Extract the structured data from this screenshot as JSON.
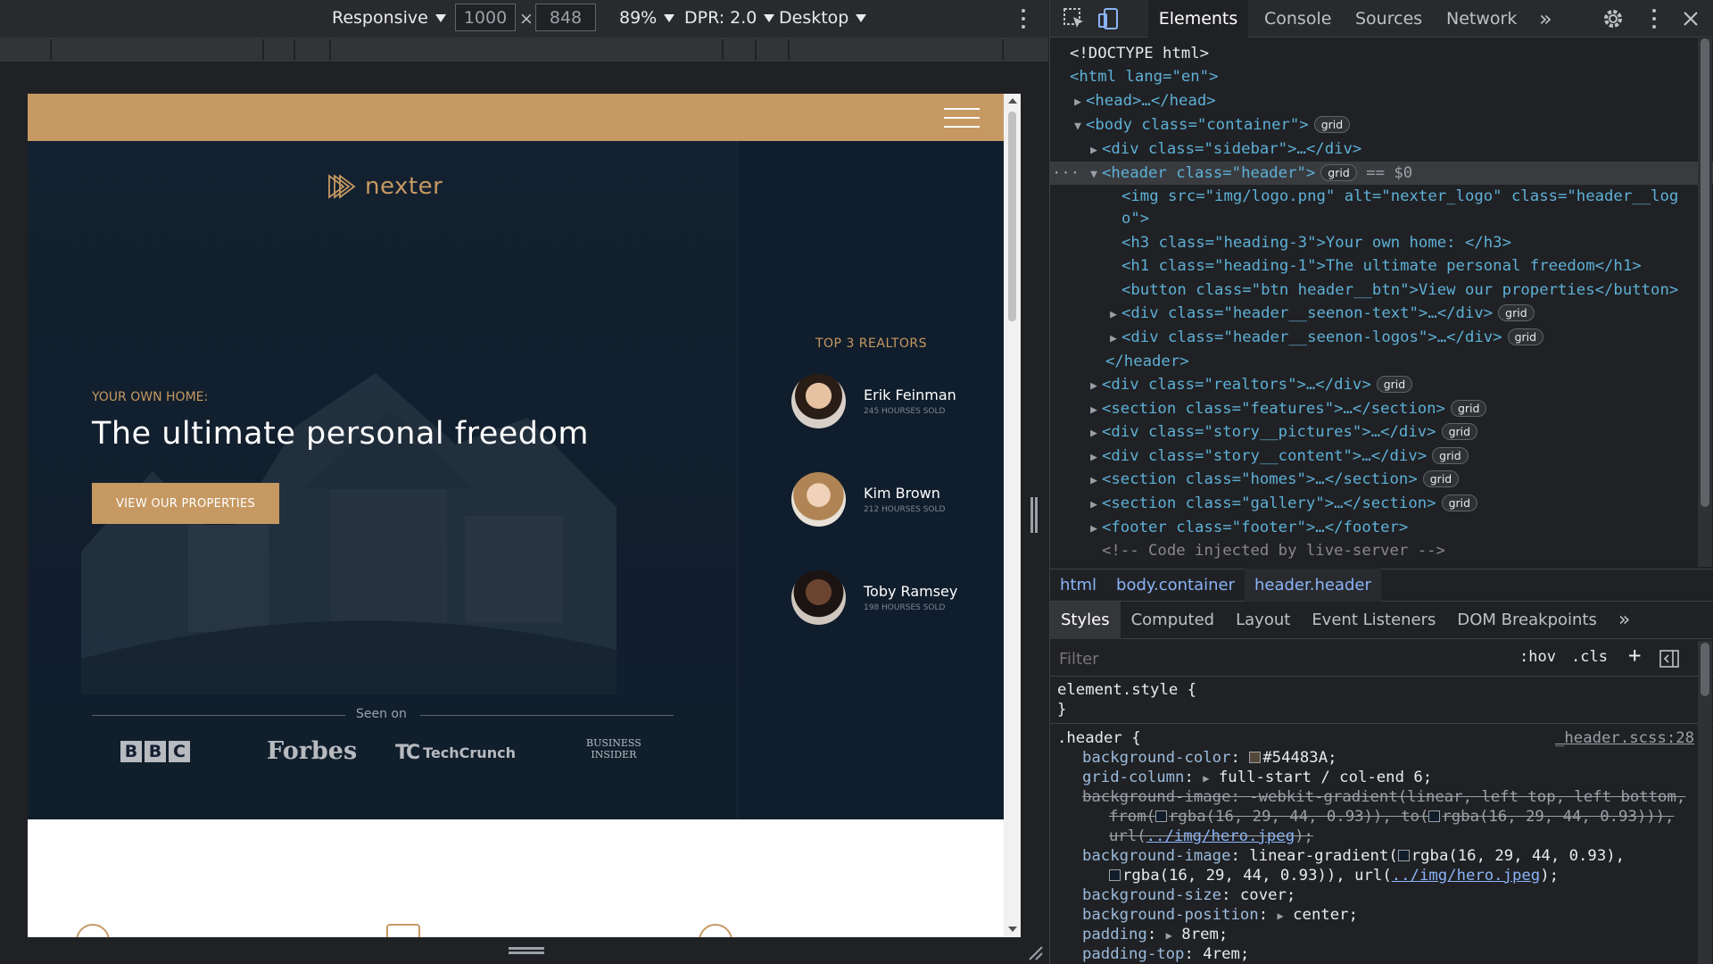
{
  "toolbar": {
    "device": "Responsive",
    "width": "1000",
    "times": "×",
    "height": "848",
    "zoom": "89%",
    "dpr": "DPR: 2.0",
    "mode": "Desktop"
  },
  "page": {
    "logo_text": "nexter",
    "heading3": "YOUR OWN HOME:",
    "heading1": "The ultimate personal freedom",
    "button": "VIEW OUR PROPERTIES",
    "seen_on": "Seen on",
    "press": {
      "bbc": [
        "B",
        "B",
        "C"
      ],
      "forbes": "Forbes",
      "techcrunch": "TechCrunch",
      "tc_mark": "TC",
      "business_insider_1": "BUSINESS",
      "business_insider_2": "INSIDER"
    },
    "realtors_title": "TOP 3 REALTORS",
    "realtors": [
      {
        "name": "Erik Feinman",
        "sold": "245 HOURSES SOLD"
      },
      {
        "name": "Kim Brown",
        "sold": "212 HOURSES SOLD"
      },
      {
        "name": "Toby Ramsey",
        "sold": "198 HOURSES SOLD"
      }
    ],
    "colors": {
      "primary": "#c69963",
      "dark": "#101d2c"
    }
  },
  "devtools": {
    "tabs": [
      "Elements",
      "Console",
      "Sources",
      "Network"
    ],
    "more": "»",
    "dom": {
      "doctype": "<!DOCTYPE html>",
      "html_open": "<html lang=\"en\">",
      "head": "<head>…</head>",
      "body_open": "<body class=\"container\">",
      "sidebar": "<div class=\"sidebar\">…</div>",
      "header_open": "<header class=\"header\">",
      "eq_dollar": "== $0",
      "img_line1": "<img src=\"img/logo.png\" alt=\"nexter_logo\" class=\"header__log",
      "img_line2": "o\">",
      "h3_line": "<h3 class=\"heading-3\">Your own home: </h3>",
      "h1_line": "<h1 class=\"heading-1\">The ultimate personal freedom</h1>",
      "button_line": "<button class=\"btn header__btn\">View our properties</button>",
      "seenon_text": "<div class=\"header__seenon-text\">…</div>",
      "seenon_logos": "<div class=\"header__seenon-logos\">…</div>",
      "header_close": "</header>",
      "realtors": "<div class=\"realtors\">…</div>",
      "features": "<section class=\"features\">…</section>",
      "story_pictures": "<div class=\"story__pictures\">…</div>",
      "story_content": "<div class=\"story__content\">…</div>",
      "homes": "<section class=\"homes\">…</section>",
      "gallery": "<section class=\"gallery\">…</section>",
      "footer": "<footer class=\"footer\">…</footer>",
      "comment": "<!-- Code injected by live-server -->",
      "grid_badge": "grid"
    },
    "breadcrumbs": [
      "html",
      "body.container",
      "header.header"
    ],
    "subtabs": [
      "Styles",
      "Computed",
      "Layout",
      "Event Listeners",
      "DOM Breakpoints"
    ],
    "filter_placeholder": "Filter",
    "hov": ":hov",
    "cls": ".cls",
    "plus": "+",
    "styles": {
      "element_style": "element.style {",
      "close": "}",
      "selector": ".header {",
      "source": "_header.scss:28",
      "bg_color_prop": "background-color",
      "bg_color_val": "#54483A;",
      "grid_col_prop": "grid-column",
      "grid_col_val": "full-start / col-end 6;",
      "bgi_old_1": "background-image: -webkit-gradient(linear, left top, left bottom,",
      "bgi_old_2a": "from(",
      "bgi_old_2b": "rgba(16, 29, 44, 0.93)), to(",
      "bgi_old_2c": "rgba(16, 29, 44, 0.93))),",
      "bgi_old_3a": "url(",
      "bgi_old_3b": "../img/hero.jpeg",
      "bgi_old_3c": ");",
      "bgi_prop": "background-image",
      "bgi_val_1": "linear-gradient(",
      "bgi_val_1b": "rgba(16, 29, 44, 0.93),",
      "bgi_val_2": "rgba(16, 29, 44, 0.93)), url(",
      "bgi_val_2b": "../img/hero.jpeg",
      "bgi_val_2c": ");",
      "bgs_prop": "background-size",
      "bgs_val": "cover;",
      "bgp_prop": "background-position",
      "bgp_val": "center;",
      "pad_prop": "padding",
      "pad_val": "8rem;",
      "padtop_prop": "padding-top",
      "padtop_val": "4rem;"
    }
  }
}
